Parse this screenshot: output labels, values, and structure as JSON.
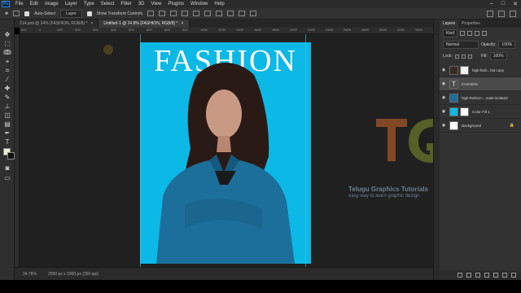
{
  "menubar": {
    "logo": "Ps",
    "items": [
      "File",
      "Edit",
      "Image",
      "Layer",
      "Type",
      "Select",
      "Filter",
      "3D",
      "View",
      "Plugins",
      "Window",
      "Help"
    ]
  },
  "options": {
    "auto_select_label": "Auto-Select",
    "target_value": "Layer",
    "transform_controls_label": "Show Transform Controls"
  },
  "document_tabs": [
    {
      "label": "214.psd @ 24% (FASHION, RGB/8) *",
      "active": false
    },
    {
      "label": "Untitled-1 @ 24.8% (FASHION, RGB/8) *",
      "active": true
    }
  ],
  "ruler": {
    "top": [
      "500",
      "0",
      "100",
      "200",
      "300",
      "400",
      "500",
      "600",
      "800",
      "900",
      "1000",
      "1200",
      "1400",
      "1600",
      "1800",
      "2000",
      "2200",
      "2400",
      "2600",
      "2800",
      "3000",
      "3200",
      "3400"
    ]
  },
  "canvas": {
    "headline": "FASHION",
    "artboard_color": "#0cb9e6",
    "guide_color": "#4cc4ec"
  },
  "watermark": {
    "title": "Telugu Graphics Tutorials",
    "subtitle": "easy way to learn graphic design"
  },
  "status": {
    "zoom": "24.76%",
    "doc_size": "2550 px x 3300 px (300 ppi)"
  },
  "layers_panel": {
    "tabs": [
      "Layers",
      "Properties"
    ],
    "kind_label": "Kind",
    "blend_mode": "Normal",
    "opacity_label": "Opacity:",
    "opacity_value": "100%",
    "lock_label": "Lock:",
    "fill_label": "Fill:",
    "fill_value": "100%",
    "layers": [
      {
        "name": "high-fash...bid copy",
        "thumb": "photo",
        "has_mask": true,
        "selected": false,
        "italic": false
      },
      {
        "name": "FASHION",
        "thumb": "type",
        "has_mask": false,
        "selected": true,
        "italic": false
      },
      {
        "name": "high-fashion-...male-isolated",
        "thumb": "photo",
        "has_mask": false,
        "selected": false,
        "italic": false
      },
      {
        "name": "Color Fill 1",
        "thumb": "fill",
        "has_mask": true,
        "selected": false,
        "italic": false
      },
      {
        "name": "Background",
        "thumb": "white",
        "has_mask": false,
        "selected": false,
        "italic": true
      }
    ]
  }
}
